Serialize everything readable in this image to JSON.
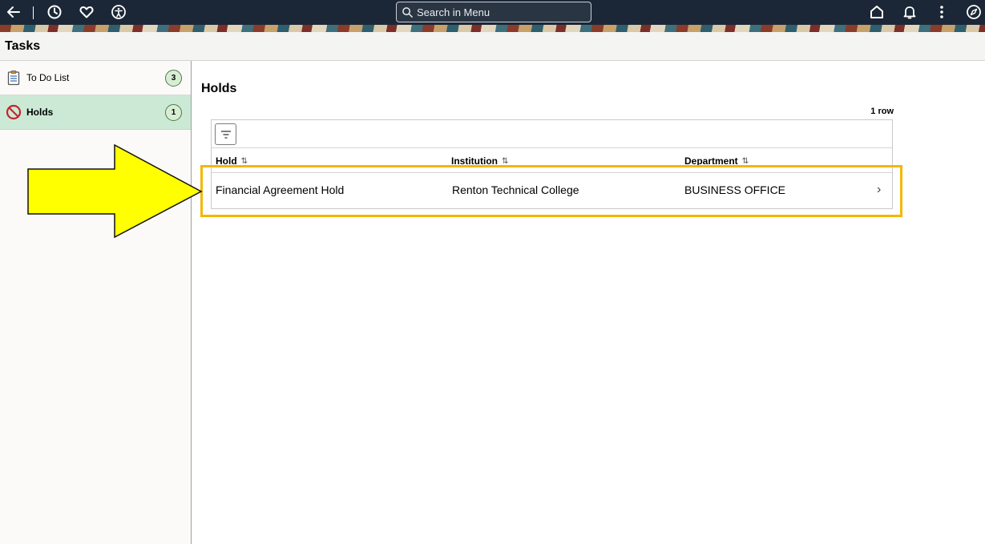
{
  "topbar": {
    "icons": [
      "back-arrow-icon",
      "recent-history-icon",
      "favorites-heart-icon",
      "accessibility-icon",
      "home-icon",
      "notifications-bell-icon",
      "actions-more-icon",
      "navigator-compass-icon"
    ],
    "search_placeholder": "Search in Menu"
  },
  "page": {
    "title": "Tasks"
  },
  "sidebar": {
    "items": [
      {
        "label": "To Do List",
        "count": "3",
        "icon": "clipboard-list-icon"
      },
      {
        "label": "Holds",
        "count": "1",
        "icon": "no-entry-icon",
        "selected": true
      }
    ]
  },
  "main": {
    "title": "Holds",
    "row_count": "1 row",
    "columns": [
      "Hold",
      "Institution",
      "Department"
    ],
    "rows": [
      {
        "hold": "Financial Agreement Hold",
        "institution": "Renton Technical College",
        "department": "BUSINESS OFFICE"
      }
    ]
  },
  "colors": {
    "topbar": "#1b2736",
    "selected_item": "#cce9d5",
    "highlight": "#f2b705",
    "arrow": "#ffff00"
  }
}
